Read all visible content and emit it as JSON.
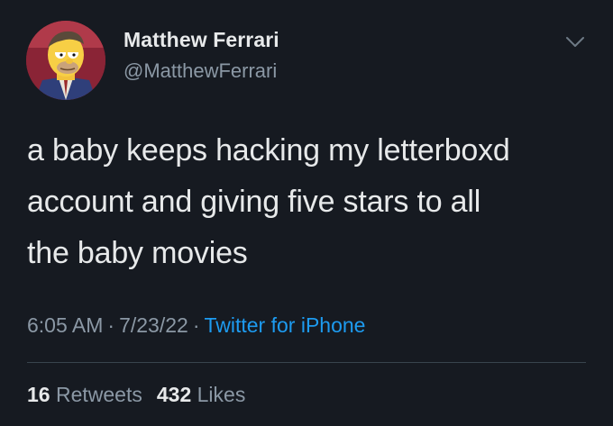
{
  "author": {
    "display_name": "Matthew Ferrari",
    "handle": "@MatthewFerrari",
    "avatar_icon": "cartoon-man-avatar"
  },
  "menu_icon": "chevron-down-icon",
  "tweet": {
    "lines": [
      "a baby keeps hacking my letterboxd",
      "account and giving five stars to all",
      "the baby movies"
    ],
    "time": "6:05 AM",
    "date": "7/23/22",
    "separator": "·",
    "source": "Twitter for iPhone"
  },
  "stats": {
    "retweets_count": "16",
    "retweets_label": "Retweets",
    "likes_count": "432",
    "likes_label": "Likes"
  },
  "colors": {
    "background": "#161a21",
    "text_primary": "#e7e9ea",
    "text_secondary": "#8b98a5",
    "link": "#1d9bf0",
    "divider": "#38444d"
  }
}
